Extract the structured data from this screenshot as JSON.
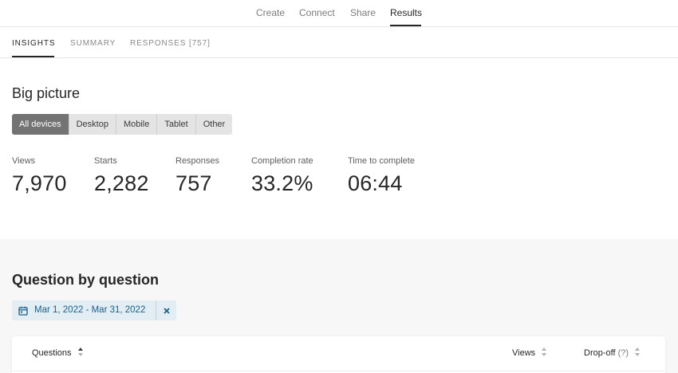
{
  "topnav": {
    "items": [
      {
        "label": "Create"
      },
      {
        "label": "Connect"
      },
      {
        "label": "Share"
      },
      {
        "label": "Results"
      }
    ]
  },
  "subnav": {
    "tabs": [
      {
        "label": "INSIGHTS"
      },
      {
        "label": "SUMMARY"
      },
      {
        "label": "RESPONSES [757]"
      }
    ]
  },
  "big_picture": {
    "title": "Big picture",
    "devices": [
      "All devices",
      "Desktop",
      "Mobile",
      "Tablet",
      "Other"
    ],
    "selected_device": "All devices",
    "stats": [
      {
        "label": "Views",
        "value": "7,970"
      },
      {
        "label": "Starts",
        "value": "2,282"
      },
      {
        "label": "Responses",
        "value": "757"
      },
      {
        "label": "Completion rate",
        "value": "33.2%"
      },
      {
        "label": "Time to complete",
        "value": "06:44"
      }
    ]
  },
  "question_by_question": {
    "title": "Question by question",
    "date_range": "Mar 1, 2022 - Mar 31, 2022",
    "clear_icon": "close-icon",
    "calendar_icon": "calendar-icon",
    "columns": {
      "questions": "Questions",
      "views": "Views",
      "dropoff": "Drop-off",
      "dropoff_help": "(?)"
    }
  },
  "colors": {
    "accent_text": "#262627",
    "segment_active": "#737373",
    "chip_background": "#e2eef4",
    "chip_text": "#1a5e8a"
  }
}
